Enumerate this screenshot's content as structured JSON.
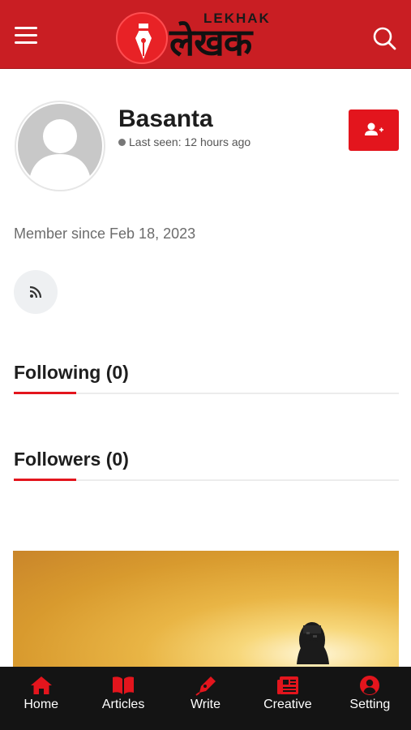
{
  "header": {
    "logo_sub": "LEKHAK",
    "logo_main": "लेखक",
    "menu_icon": "hamburger-icon",
    "search_icon": "search-icon"
  },
  "profile": {
    "name": "Basanta",
    "last_seen": "Last seen: 12 hours ago",
    "member_since": "Member since Feb 18, 2023",
    "follow_icon": "add-user-icon",
    "rss_icon": "rss-icon"
  },
  "sections": {
    "following": "Following (0)",
    "followers": "Followers (0)"
  },
  "nav": {
    "items": [
      {
        "label": "Home",
        "icon": "home-icon"
      },
      {
        "label": "Articles",
        "icon": "book-icon"
      },
      {
        "label": "Write",
        "icon": "pen-icon"
      },
      {
        "label": "Creative",
        "icon": "newspaper-icon"
      },
      {
        "label": "Setting",
        "icon": "user-circle-icon"
      }
    ]
  },
  "colors": {
    "brand_red": "#c91e23",
    "accent_red": "#e3151d",
    "nav_bg": "#141414"
  }
}
